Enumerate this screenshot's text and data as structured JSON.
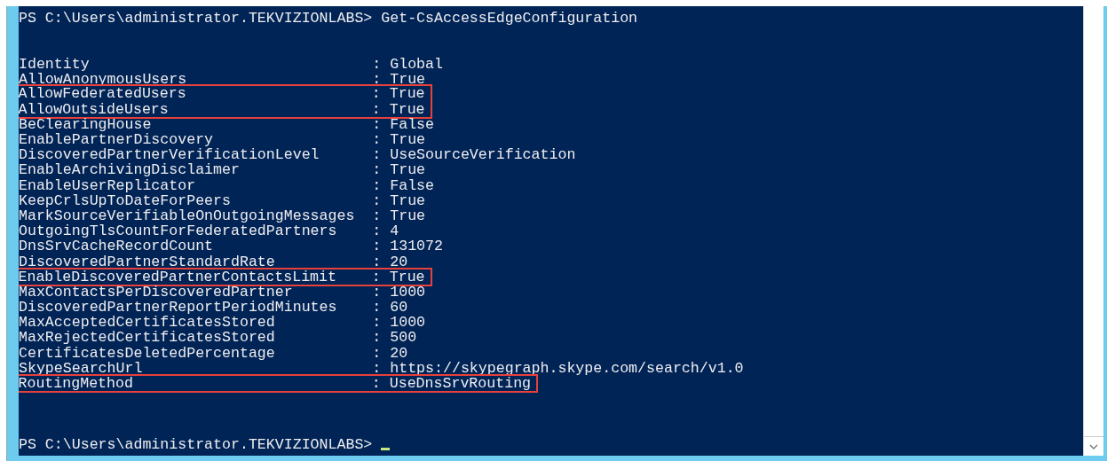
{
  "console": {
    "command_line": {
      "prompt": "PS C:\\Users\\administrator.TEKVIZIONLABS>",
      "command": "Get-CsAccessEdgeConfiguration"
    },
    "properties": [
      {
        "name": "Identity",
        "value": ": Global",
        "highlighted": false
      },
      {
        "name": "AllowAnonymousUsers",
        "value": ": True",
        "highlighted": false
      },
      {
        "name": "AllowFederatedUsers",
        "value": ": True",
        "highlighted": true
      },
      {
        "name": "AllowOutsideUsers",
        "value": ": True",
        "highlighted": true
      },
      {
        "name": "BeClearingHouse",
        "value": ": False",
        "highlighted": false
      },
      {
        "name": "EnablePartnerDiscovery",
        "value": ": True",
        "highlighted": false
      },
      {
        "name": "DiscoveredPartnerVerificationLevel",
        "value": ": UseSourceVerification",
        "highlighted": false
      },
      {
        "name": "EnableArchivingDisclaimer",
        "value": ": True",
        "highlighted": false
      },
      {
        "name": "EnableUserReplicator",
        "value": ": False",
        "highlighted": false
      },
      {
        "name": "KeepCrlsUpToDateForPeers",
        "value": ": True",
        "highlighted": false
      },
      {
        "name": "MarkSourceVerifiableOnOutgoingMessages",
        "value": ": True",
        "highlighted": false
      },
      {
        "name": "OutgoingTlsCountForFederatedPartners",
        "value": ": 4",
        "highlighted": false
      },
      {
        "name": "DnsSrvCacheRecordCount",
        "value": ": 131072",
        "highlighted": false
      },
      {
        "name": "DiscoveredPartnerStandardRate",
        "value": ": 20",
        "highlighted": false
      },
      {
        "name": "EnableDiscoveredPartnerContactsLimit",
        "value": ": True",
        "highlighted": true
      },
      {
        "name": "MaxContactsPerDiscoveredPartner",
        "value": ": 1000",
        "highlighted": false
      },
      {
        "name": "DiscoveredPartnerReportPeriodMinutes",
        "value": ": 60",
        "highlighted": false
      },
      {
        "name": "MaxAcceptedCertificatesStored",
        "value": ": 1000",
        "highlighted": false
      },
      {
        "name": "MaxRejectedCertificatesStored",
        "value": ": 500",
        "highlighted": false
      },
      {
        "name": "CertificatesDeletedPercentage",
        "value": ": 20",
        "highlighted": false
      },
      {
        "name": "SkypeSearchUrl",
        "value": ": https://skypegraph.skype.com/search/v1.0",
        "highlighted": false
      },
      {
        "name": "RoutingMethod",
        "value": ": UseDnsSrvRouting",
        "highlighted": true
      }
    ],
    "prompt_line": {
      "prompt": "PS C:\\Users\\administrator.TEKVIZIONLABS>"
    }
  }
}
